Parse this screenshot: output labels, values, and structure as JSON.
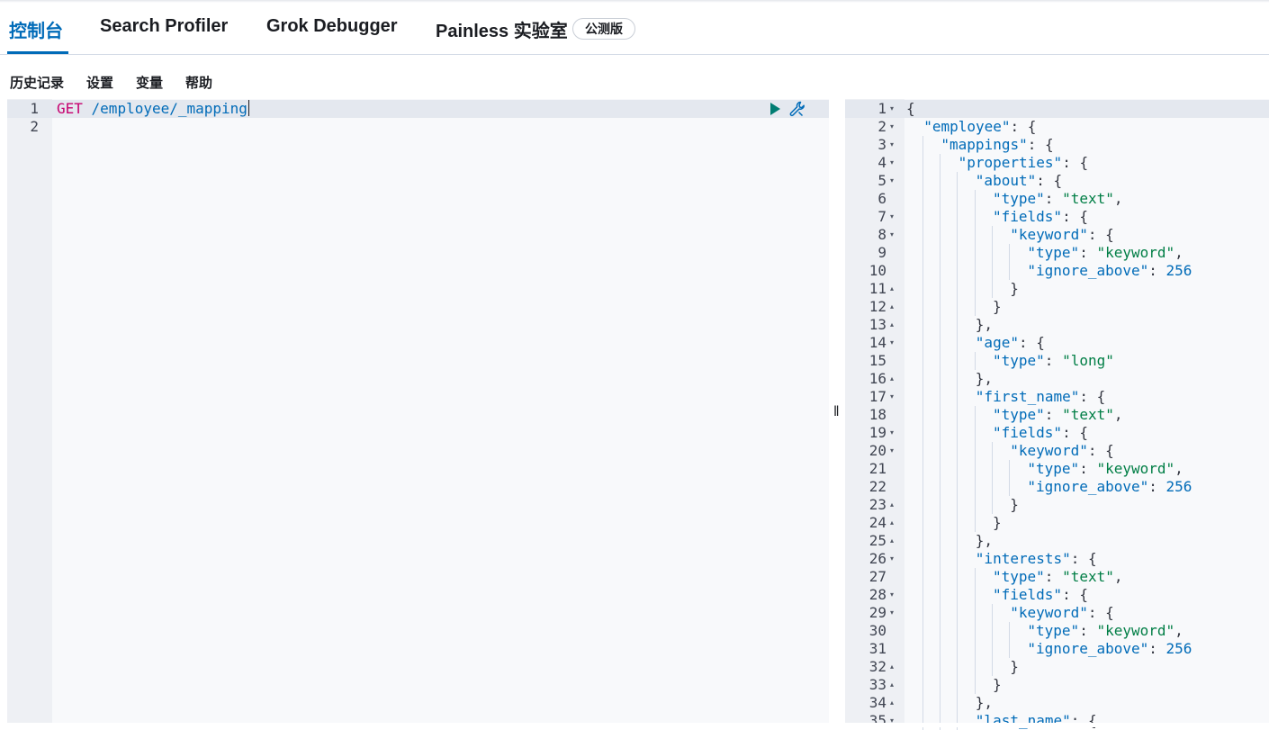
{
  "tabs": [
    {
      "label": "控制台",
      "selected": true
    },
    {
      "label": "Search Profiler",
      "selected": false
    },
    {
      "label": "Grok Debugger",
      "selected": false
    },
    {
      "label": "Painless 实验室",
      "selected": false
    }
  ],
  "beta_badge": "公测版",
  "menu": {
    "history": "历史记录",
    "settings": "设置",
    "variables": "变量",
    "help": "帮助"
  },
  "request_editor": {
    "line_numbers": [
      "1",
      "2"
    ],
    "method": "GET",
    "path": " /employee/_mapping",
    "run_icon": "play-icon",
    "options_icon": "wrench-icon"
  },
  "splitter_icon": "resize-handle-icon",
  "response": {
    "lines": [
      {
        "n": "1",
        "fold": "▾",
        "text": "{"
      },
      {
        "n": "2",
        "fold": "▾",
        "key": "employee",
        "after": ": {"
      },
      {
        "n": "3",
        "fold": "▾",
        "key": "mappings",
        "after": ": {"
      },
      {
        "n": "4",
        "fold": "▾",
        "key": "properties",
        "after": ": {"
      },
      {
        "n": "5",
        "fold": "▾",
        "key": "about",
        "after": ": {"
      },
      {
        "n": "6",
        "fold": "",
        "key": "type",
        "val": "text",
        "after": ","
      },
      {
        "n": "7",
        "fold": "▾",
        "key": "fields",
        "after": ": {"
      },
      {
        "n": "8",
        "fold": "▾",
        "key": "keyword",
        "after": ": {"
      },
      {
        "n": "9",
        "fold": "",
        "key": "type",
        "val": "keyword",
        "after": ","
      },
      {
        "n": "10",
        "fold": "",
        "key": "ignore_above",
        "num": "256"
      },
      {
        "n": "11",
        "fold": "▴",
        "text": "}"
      },
      {
        "n": "12",
        "fold": "▴",
        "text": "}"
      },
      {
        "n": "13",
        "fold": "▴",
        "text": "},"
      },
      {
        "n": "14",
        "fold": "▾",
        "key": "age",
        "after": ": {"
      },
      {
        "n": "15",
        "fold": "",
        "key": "type",
        "val": "long"
      },
      {
        "n": "16",
        "fold": "▴",
        "text": "},"
      },
      {
        "n": "17",
        "fold": "▾",
        "key": "first_name",
        "after": ": {"
      },
      {
        "n": "18",
        "fold": "",
        "key": "type",
        "val": "text",
        "after": ","
      },
      {
        "n": "19",
        "fold": "▾",
        "key": "fields",
        "after": ": {"
      },
      {
        "n": "20",
        "fold": "▾",
        "key": "keyword",
        "after": ": {"
      },
      {
        "n": "21",
        "fold": "",
        "key": "type",
        "val": "keyword",
        "after": ","
      },
      {
        "n": "22",
        "fold": "",
        "key": "ignore_above",
        "num": "256"
      },
      {
        "n": "23",
        "fold": "▴",
        "text": "}"
      },
      {
        "n": "24",
        "fold": "▴",
        "text": "}"
      },
      {
        "n": "25",
        "fold": "▴",
        "text": "},"
      },
      {
        "n": "26",
        "fold": "▾",
        "key": "interests",
        "after": ": {"
      },
      {
        "n": "27",
        "fold": "",
        "key": "type",
        "val": "text",
        "after": ","
      },
      {
        "n": "28",
        "fold": "▾",
        "key": "fields",
        "after": ": {"
      },
      {
        "n": "29",
        "fold": "▾",
        "key": "keyword",
        "after": ": {"
      },
      {
        "n": "30",
        "fold": "",
        "key": "type",
        "val": "keyword",
        "after": ","
      },
      {
        "n": "31",
        "fold": "",
        "key": "ignore_above",
        "num": "256"
      },
      {
        "n": "32",
        "fold": "▴",
        "text": "}"
      },
      {
        "n": "33",
        "fold": "▴",
        "text": "}"
      },
      {
        "n": "34",
        "fold": "▴",
        "text": "},"
      },
      {
        "n": "35",
        "fold": "▾",
        "key": "last_name",
        "after": ": {"
      }
    ]
  }
}
